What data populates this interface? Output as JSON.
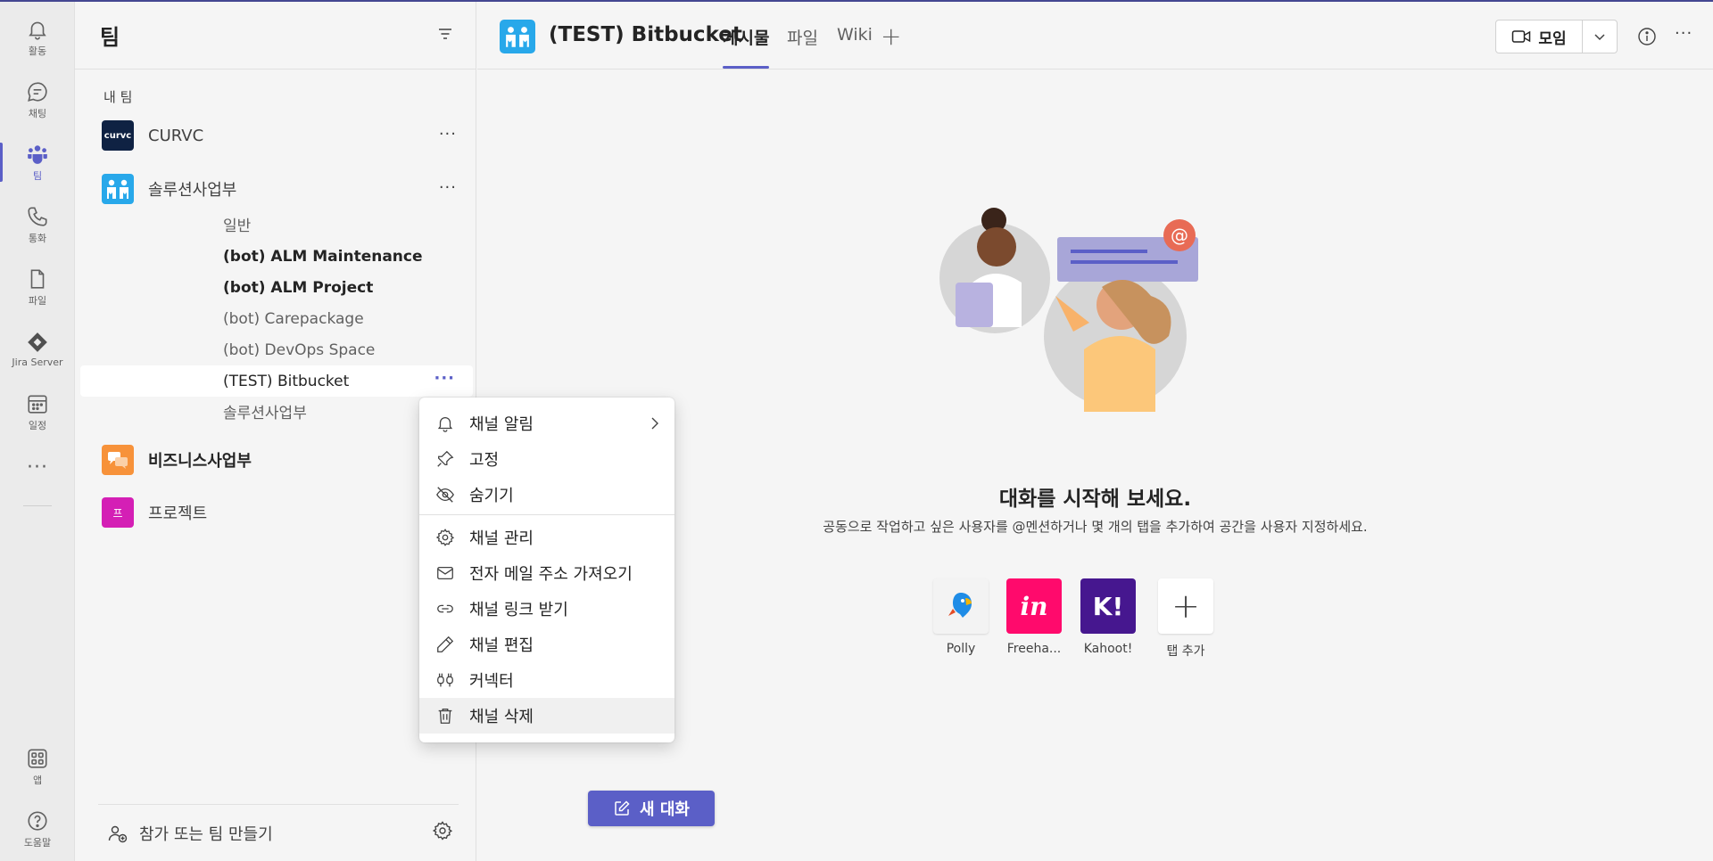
{
  "rail": {
    "items": [
      {
        "label": "활동",
        "icon": "bell-icon"
      },
      {
        "label": "채팅",
        "icon": "chat-icon"
      },
      {
        "label": "팀",
        "icon": "teams-icon"
      },
      {
        "label": "통화",
        "icon": "phone-icon"
      },
      {
        "label": "파일",
        "icon": "file-icon"
      },
      {
        "label": "Jira Server",
        "icon": "jira-icon"
      },
      {
        "label": "일정",
        "icon": "calendar-icon"
      },
      {
        "label": "앱",
        "icon": "apps-icon"
      },
      {
        "label": "도움말",
        "icon": "help-icon"
      }
    ],
    "more": "···"
  },
  "panel": {
    "title": "팀",
    "section_label": "내 팀",
    "teams": [
      {
        "name": "CURVC",
        "logo_text": "curvc",
        "logo_color": "#0f2243"
      },
      {
        "name": "솔루션사업부",
        "logo_color": "#28a8ea"
      },
      {
        "name": "비즈니스사업부",
        "logo_color": "#f7923a"
      },
      {
        "name": "프로젝트",
        "logo_text": "프",
        "logo_color": "#d41fb5"
      }
    ],
    "channels": [
      {
        "label": "일반"
      },
      {
        "label": "(bot) ALM Maintenance"
      },
      {
        "label": "(bot) ALM Project"
      },
      {
        "label": "(bot) Carepackage"
      },
      {
        "label": "(bot) DevOps Space"
      },
      {
        "label": "(TEST) Bitbucket"
      },
      {
        "label": "솔루션사업부"
      }
    ],
    "more": "···",
    "footer_label": "참가 또는 팀 만들기"
  },
  "topbar": {
    "title": "(TEST) Bitbucket",
    "tabs": [
      "게시물",
      "파일",
      "Wiki"
    ],
    "add": "+",
    "meet_label": "모임",
    "more": "···"
  },
  "menu": {
    "items": [
      {
        "label": "채널 알림",
        "icon": "bell-icon"
      },
      {
        "label": "고정",
        "icon": "pin-icon"
      },
      {
        "label": "숨기기",
        "icon": "eye-off-icon"
      },
      {
        "label": "채널 관리",
        "icon": "gear-icon"
      },
      {
        "label": "전자 메일 주소 가져오기",
        "icon": "mail-icon"
      },
      {
        "label": "채널 링크 받기",
        "icon": "link-icon"
      },
      {
        "label": "채널 편집",
        "icon": "pencil-icon"
      },
      {
        "label": "커넥터",
        "icon": "connector-icon"
      },
      {
        "label": "채널 삭제",
        "icon": "trash-icon"
      }
    ]
  },
  "main": {
    "empty_title": "대화를 시작해 보세요.",
    "empty_subtitle": "공동으로 작업하고 싶은 사용자를 @멘션하거나 몇 개의 탭을 추가하여 공간을 사용자 지정하세요.",
    "apps": [
      {
        "label": "Polly",
        "color": "#f3f3f3"
      },
      {
        "label": "Freeha...",
        "tile_text": "in",
        "color": "#ff0a6c"
      },
      {
        "label": "Kahoot!",
        "tile_text": "K!",
        "color": "#46178f"
      },
      {
        "label": "탭 추가",
        "tile_text": "+",
        "color": "#ffffff"
      }
    ],
    "new_conversation": "새 대화"
  },
  "colors": {
    "accent": "#5b5fc7",
    "rail_bg": "#ebebeb",
    "panel_bg": "#f5f5f5"
  }
}
